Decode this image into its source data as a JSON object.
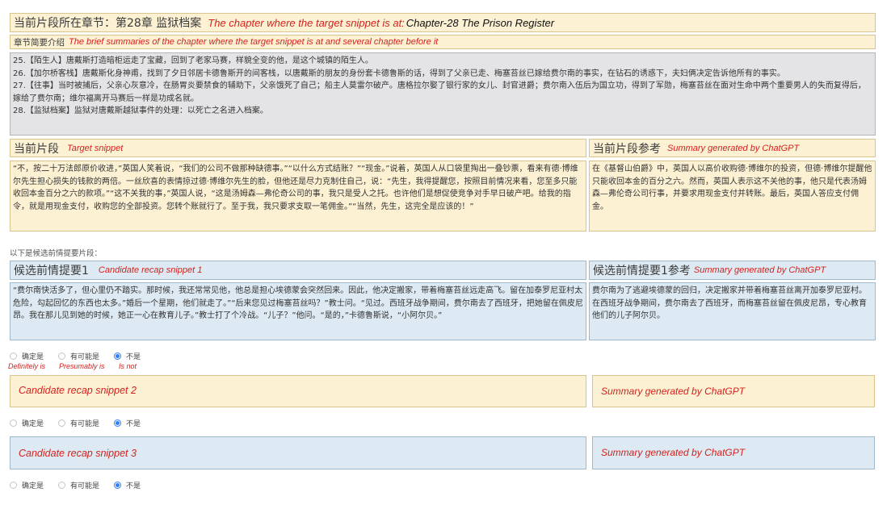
{
  "chapter_bar": {
    "zh": "当前片段所在章节：第28章 监狱档案",
    "en_label": "The chapter where the target snippet is at:",
    "en_chapter": "Chapter-28 The Prison Register"
  },
  "summaries_bar": {
    "zh": "章节简要介绍",
    "en": "The brief summaries of the chapter where the target snippet is at and several chapter before it"
  },
  "chapter_summaries": [
    "25.【陌生人】唐戴斯打造暗柜运走了宝藏，回到了老家马赛，样貌全变的他，是这个城镇的陌生人。",
    "26.【加尔桥客栈】唐戴斯化身神甫，找到了夕日邻居卡德鲁斯开的间客栈，以唐戴斯的朋友的身份套卡德鲁斯的话，得到了父亲已走、梅塞苔丝已嫁给费尔南的事实，在钻石的诱惑下，夫妇俩决定告诉他所有的事实。",
    "27.【往事】当时被捕后，父亲心灰意冷，在肠胃炎要禁食的辅助下，父亲饿死了自己；船主人莫雷尔破产。唐格拉尔娶了银行家的女儿、封官进爵；费尔南入伍后为国立功，得到了军勋，梅塞苔丝在面对生命中两个重要男人的失而复得后，嫁给了费尔南；维尔福离开马赛后一样是功成名就。",
    "28.【监狱档案】监狱对唐戴斯越狱事件的处理：以死亡之名进入档案。"
  ],
  "target": {
    "zh": "当前片段",
    "en": "Target snippet",
    "text": "“不，按二十万法郎原价收进，”英国人笑着说，“我们的公司不做那种缺德事。”“以什么方式结账？”“现金。”说着，英国人从口袋里掏出一叠钞票，看来有德·博维尔先生担心损失的钱款的两倍。一丝欣喜的表情掠过德·博维尔先生的脸，但他还是尽力克制住自己，说：“先生，我得提醒您，按照目前情况来看，您至多只能收回本金百分之六的款项。”“这不关我的事，”英国人说，“这是汤姆森—弗伦奇公司的事，我只是受人之托。也许他们是想促使竞争对手早日破产吧。给我的指令，就是用现金支付，收购您的全部投资。您转个账就行了。至于我，我只要求支取一笔佣金。”“当然，先生，这完全是应该的！”"
  },
  "target_ref": {
    "zh": "当前片段参考",
    "en": "Summary generated by ChatGPT",
    "text": "在《基督山伯爵》中，英国人以高价收购德·博维尔的投资，但德·博维尔提醒他只能收回本金的百分之六。然而，英国人表示这不关他的事，他只是代表汤姆森—弗伦奇公司行事，并要求用现金支付并转账。最后，英国人答应支付佣金。"
  },
  "candidates_intro": "以下是候选前情提要片段：",
  "candidate1": {
    "zh": "候选前情提要1",
    "en": "Candidate recap snippet 1",
    "text": "“费尔南快活多了，但心里仍不踏实。那时候，我还常常见他，他总是担心埃德蒙会突然回来。因此，他决定搬家，带着梅塞苔丝远走高飞。留在加泰罗尼亚村太危险，勾起回忆的东西也太多。”婚后一个星期，他们就走了。”“后来您见过梅塞苔丝吗？”教士问。“见过。西班牙战争期间，费尔南去了西班牙，把她留在佩皮尼昂。我在那儿见到她的时候，她正一心在教育儿子。”教士打了个冷战。“儿子？”他问。“是的，”卡德鲁斯说，“小阿尔贝。”",
    "ref_zh": "候选前情提要1参考",
    "ref_en": "Summary generated by ChatGPT",
    "ref_text": "费尔南为了逃避埃德蒙的回归，决定搬家并带着梅塞苔丝离开加泰罗尼亚村。在西班牙战争期间，费尔南去了西班牙，而梅塞苔丝留在佩皮尼昂，专心教育他们的儿子阿尔贝。"
  },
  "options": {
    "definitely": "确定是",
    "presumably": "有可能是",
    "not": "不是",
    "definitely_en": "Definitely is",
    "presumably_en": "Presumably is",
    "not_en": "Is not",
    "selected": "不是"
  },
  "candidate2": {
    "en": "Candidate recap snippet 2",
    "ref_en": "Summary generated by ChatGPT"
  },
  "candidate3": {
    "en": "Candidate recap snippet 3",
    "ref_en": "Summary generated by ChatGPT"
  },
  "colors": {
    "yellow_fill": "#fdf1d4",
    "gray_fill": "#e4e4e6",
    "blue_fill": "#ddeaf3",
    "annotation_red": "#d4211d",
    "radio_blue": "#2d7ff9"
  }
}
